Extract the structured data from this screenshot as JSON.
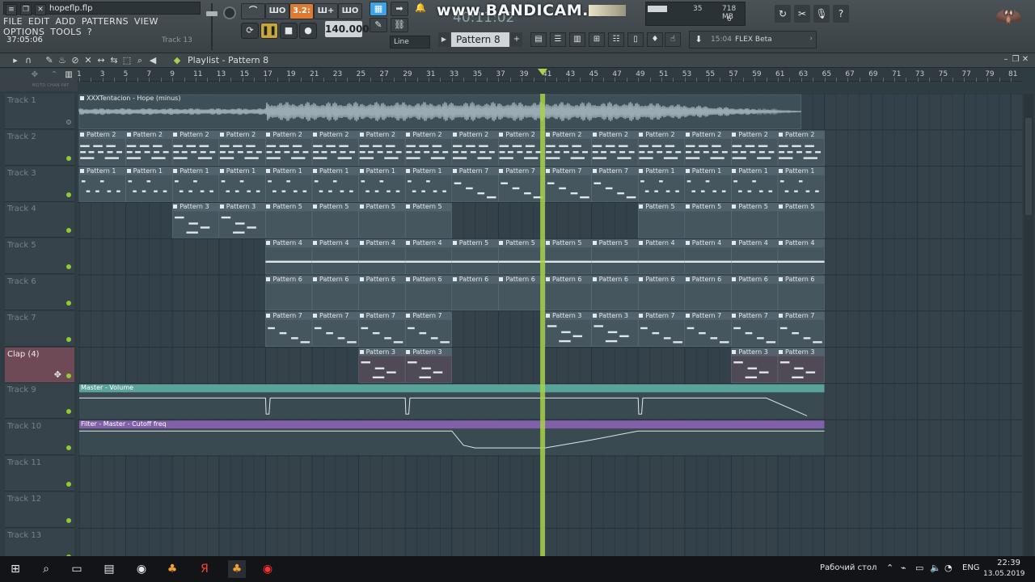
{
  "app": {
    "filename": "hopeflp.flp",
    "menu": [
      "FILE",
      "EDIT",
      "ADD",
      "PATTERNS",
      "VIEW",
      "OPTIONS",
      "TOOLS",
      "?"
    ],
    "time": "37:05:06",
    "hint": "Track 13"
  },
  "transport": {
    "tempo": "140.000",
    "row1": [
      "ШО",
      "3.2:",
      "Ш+",
      "ШО"
    ],
    "play_icon": "❚❚",
    "stop_icon": "■",
    "record_icon": "●",
    "loop_icon": "⟳"
  },
  "mode": {
    "line_select": "Line"
  },
  "recorder": {
    "watermark": "www.BANDICAM.com",
    "clock": "40:11:02"
  },
  "cpu": {
    "cpu": "35",
    "memory": "718 MB",
    "polyphony": "6"
  },
  "pattern_selector": {
    "name": "Pattern 8",
    "plus": "+"
  },
  "news": {
    "time": "15:04",
    "text": "FLEX Beta",
    "chevron": "›"
  },
  "playlist": {
    "title": "Playlist - Pattern 8",
    "ruler": [
      1,
      3,
      5,
      7,
      9,
      11,
      13,
      15,
      17,
      19,
      21,
      23,
      25,
      27,
      29,
      31,
      33,
      35,
      37,
      39,
      41,
      43,
      45,
      47,
      49,
      51,
      53,
      55,
      57,
      59,
      61,
      63,
      65,
      67,
      69,
      71,
      73,
      75,
      77,
      79,
      81
    ],
    "playhead_bar": 40.8,
    "sub_labels": "MOTD  CHAN  PAT",
    "tracks": [
      {
        "name": "Track 1"
      },
      {
        "name": "Track 2"
      },
      {
        "name": "Track 3"
      },
      {
        "name": "Track 4"
      },
      {
        "name": "Track 5"
      },
      {
        "name": "Track 6"
      },
      {
        "name": "Track 7"
      },
      {
        "name": "Clap (4)"
      },
      {
        "name": "Track 9"
      },
      {
        "name": "Track 10"
      },
      {
        "name": "Track 11"
      },
      {
        "name": "Track 12"
      },
      {
        "name": "Track 13"
      }
    ],
    "audio_clip": "XXXTentacion - Hope (minus)",
    "auto_volume": "Master - Volume",
    "auto_filter": "Filter - Master - Cutoff freq"
  },
  "taskbar": {
    "desktop_label": "Рабочий стол",
    "lang": "ENG",
    "time": "22:39",
    "date": "13.05.2019"
  },
  "colors": {
    "accent_orange": "#e07a30",
    "play_yellow": "#c9a53a",
    "playhead_green": "#a8d24a",
    "mode_blue": "#3ea3e4",
    "auto_volume": "#5aa39b",
    "auto_filter": "#8060a8",
    "clip": "#4a5b64"
  }
}
